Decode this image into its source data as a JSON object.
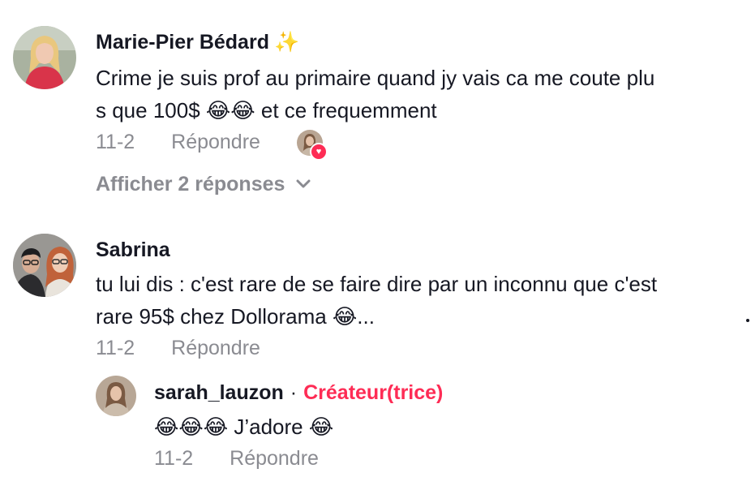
{
  "comments": [
    {
      "username": "Marie-Pier Bédard",
      "badge": "✨",
      "text_line1": "Crime je suis prof au primaire quand jy vais ca me coute plu",
      "text_line2": "s que 100$ 😂😂 et ce frequemment",
      "date": "11-2",
      "reply_label": "Répondre",
      "view_replies_label": "Afficher 2 réponses"
    },
    {
      "username": "Sabrina",
      "text_line1": "tu lui dis : c'est rare de se faire dire par un inconnu que c'est",
      "text_line2": "rare 95$ chez Dollorama 😂...",
      "date": "11-2",
      "reply_label": "Répondre",
      "reply": {
        "username": "sarah_lauzon",
        "separator": "·",
        "creator_label": "Créateur(trice)",
        "text": "😂😂😂 J’adore 😂",
        "date": "11-2",
        "reply_label": "Répondre"
      }
    }
  ],
  "colors": {
    "text": "#161823",
    "muted": "#8a8b91",
    "creator_accent": "#fe2c55"
  },
  "icons": {
    "liked_by_creator": "heart-icon",
    "expand": "chevron-down-icon",
    "badge": "sparkles-icon"
  }
}
